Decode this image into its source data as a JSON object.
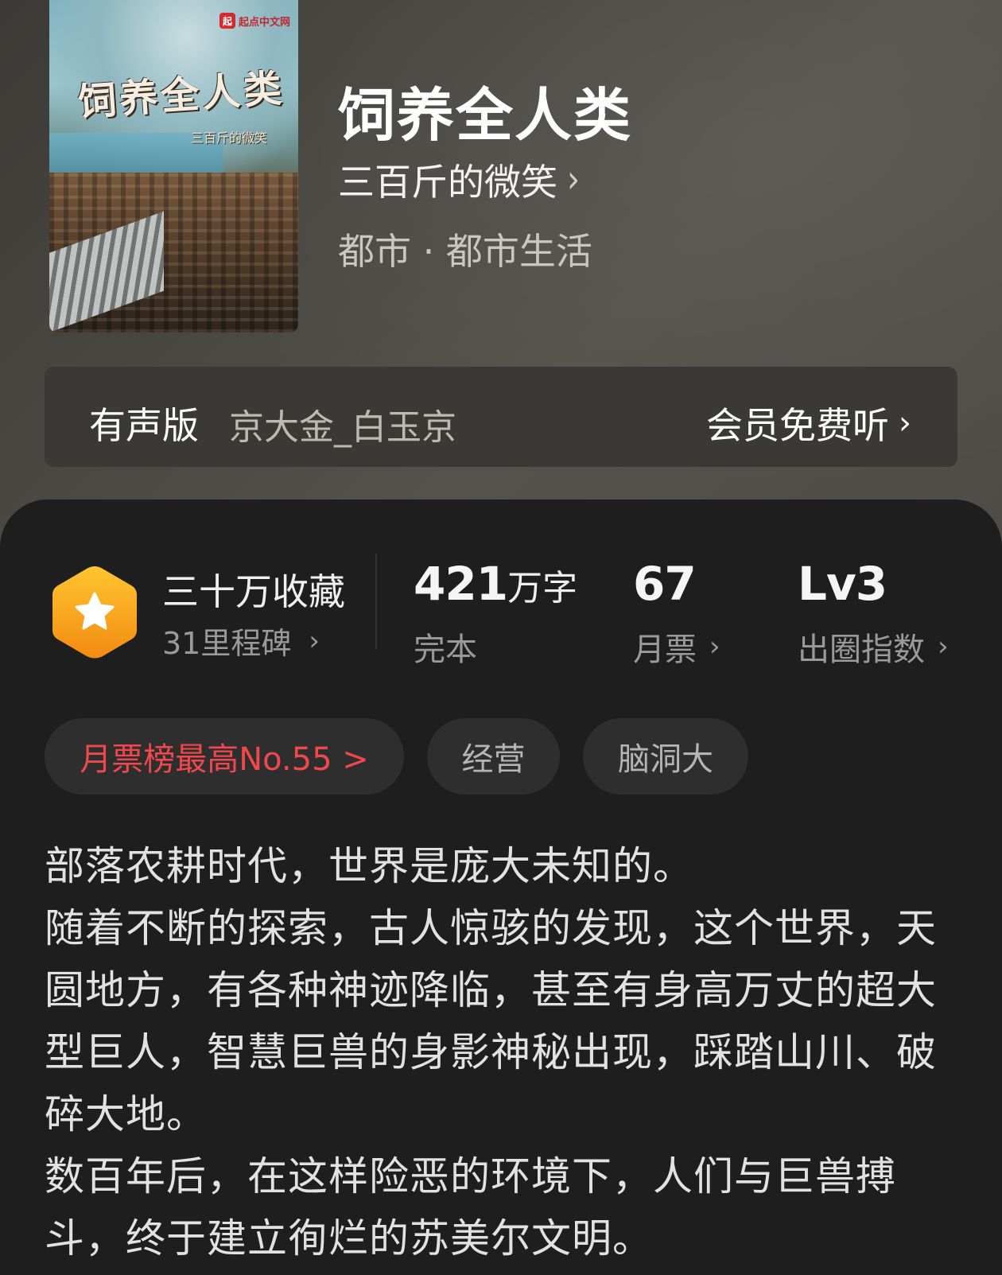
{
  "book": {
    "cover": {
      "publisher_logo": "起点中文网",
      "logo_mark": "起",
      "cover_title": "饲养全人类",
      "cover_author": "三百斤的微笑"
    },
    "title": "饲养全人类",
    "author": "三百斤的微笑",
    "genre": "都市 · 都市生活"
  },
  "audio": {
    "label": "有声版",
    "narrator": "京大金_白玉京",
    "cta": "会员免费听"
  },
  "stats": {
    "favorites": "三十万收藏",
    "milestones": "31里程碑",
    "words_number": "421",
    "words_unit": "万字",
    "status": "完本",
    "monthly_votes": "67",
    "monthly_votes_label": "月票",
    "level": "Lv3",
    "index_label": "出圈指数"
  },
  "tags": {
    "rank": "月票榜最高No.55 >",
    "items": [
      "经营",
      "脑洞大"
    ]
  },
  "synopsis": [
    "部落农耕时代，世界是庞大未知的。",
    "随着不断的探索，古人惊骇的发现，这个世界，天圆地方，有各种神迹降临，甚至有身高万丈的超大型巨人，智慧巨兽的身影神秘出现，踩踏山川、破碎大地。",
    "数百年后，在这样险恶的环境下，人们与巨兽搏斗，终于建立徇烂的苏美尔文明。"
  ],
  "icons": {
    "author_chevron": "chevron-right-icon",
    "badge": "star-hexagon-icon"
  },
  "colors": {
    "badge_orange": "#f7a21b",
    "rank_red": "#f0484d",
    "sheet_bg": "#1e1e1e"
  }
}
